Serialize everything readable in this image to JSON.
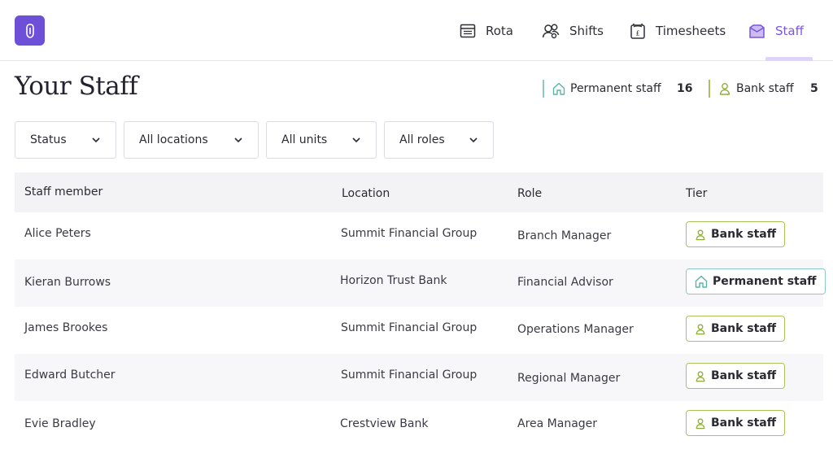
{
  "nav": {
    "items": [
      {
        "label": "Rota",
        "icon": "calendar-icon"
      },
      {
        "label": "Shifts",
        "icon": "people-icon"
      },
      {
        "label": "Timesheets",
        "icon": "timesheet-icon"
      },
      {
        "label": "Staff",
        "icon": "staff-icon",
        "active": true
      }
    ]
  },
  "page": {
    "title": "Your Staff"
  },
  "counters": {
    "permanent": {
      "label": "Permanent staff",
      "count": "16",
      "icon": "home-icon"
    },
    "bank": {
      "label": "Bank staff",
      "count": "5",
      "icon": "person-icon"
    }
  },
  "filters": [
    {
      "label": "Status"
    },
    {
      "label": "All locations"
    },
    {
      "label": "All units"
    },
    {
      "label": "All roles"
    }
  ],
  "table": {
    "headers": [
      "Staff member",
      "Location",
      "Role",
      "Tier"
    ],
    "rows": [
      {
        "name": "Alice Peters",
        "location": "Summit Financial Group",
        "role": "Branch Manager",
        "tier": "Bank staff"
      },
      {
        "name": "Kieran Burrows",
        "location": "Horizon Trust Bank",
        "role": "Financial Advisor",
        "tier": "Permanent staff"
      },
      {
        "name": "James Brookes",
        "location": "Summit Financial Group",
        "role": "Operations Manager",
        "tier": "Bank staff"
      },
      {
        "name": "Edward Butcher",
        "location": "Summit Financial Group",
        "role": "Regional Manager",
        "tier": "Bank staff"
      },
      {
        "name": "Evie Bradley",
        "location": "Crestview Bank",
        "role": "Area Manager",
        "tier": "Bank staff"
      }
    ]
  },
  "colors": {
    "accent": "#7b55e0",
    "logo": "#6e4fd8",
    "bank_border": "#a9c35a",
    "permanent_border": "#8ccbc5"
  }
}
